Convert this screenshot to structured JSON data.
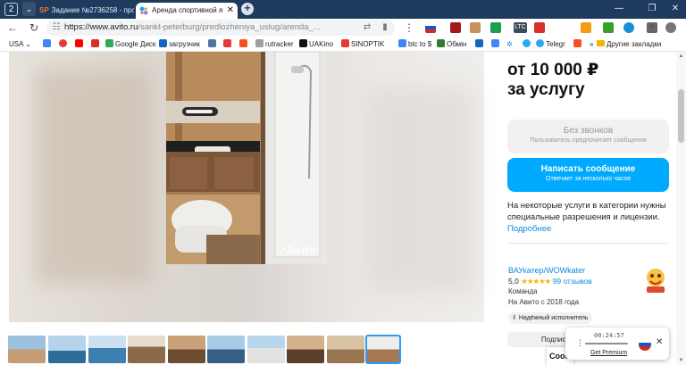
{
  "browser": {
    "tab_counter": "2",
    "tabs": [
      {
        "label": "Задание №2736258 - про",
        "active": false,
        "favicon_text": "SP"
      },
      {
        "label": "Аренда спортивной я",
        "active": true
      }
    ],
    "url_host": "https://www.avito.ru",
    "url_path": "/sankt-peterburg/predlozheniya_uslug/arenda_...",
    "extensions": [
      {
        "name": "flag-ru-icon",
        "color": "#d52b1e",
        "text": ""
      },
      {
        "name": "shield-ext-icon",
        "color": "#a11a1a",
        "text": ""
      },
      {
        "name": "face-ext-icon",
        "color": "#c9905a",
        "text": ""
      },
      {
        "name": "ext-green-icon",
        "color": "#1a9e52",
        "text": ""
      },
      {
        "name": "ltc-ext-icon",
        "color": "#3b4a5e",
        "text": "LTC"
      },
      {
        "name": "ext-red-icon",
        "color": "#d9302b",
        "text": ""
      },
      {
        "name": "download-ext-icon",
        "color": "#37a12b",
        "text": ""
      },
      {
        "name": "skype-ext-icon",
        "color": "#1b8fd6",
        "text": ""
      },
      {
        "name": "extensions-icon",
        "color": "#666666",
        "text": ""
      },
      {
        "name": "profile-icon",
        "color": "#777777",
        "text": ""
      }
    ],
    "bookmarks": [
      {
        "label": "USA",
        "color": "#ffffff"
      },
      {
        "label": "",
        "color": "#4285f4"
      },
      {
        "label": "",
        "color": "#e53935"
      },
      {
        "label": "",
        "color": "#ff0000"
      },
      {
        "label": "",
        "color": "#d93025"
      },
      {
        "label": "Google Диск",
        "color": "#34a853"
      },
      {
        "label": "загрузчик",
        "color": "#1565c0"
      },
      {
        "label": "",
        "color": "#4a76a8"
      },
      {
        "label": "",
        "color": "#e53935"
      },
      {
        "label": "",
        "color": "#f4511e"
      },
      {
        "label": "rutracker",
        "color": "#9e9e9e"
      },
      {
        "label": "UAKino",
        "color": "#111111"
      },
      {
        "label": "SINOPTIK",
        "color": "#e53935"
      },
      {
        "label": "btc to $",
        "color": "#4285f4"
      },
      {
        "label": "Обмін",
        "color": "#2e7d32"
      },
      {
        "label": "",
        "color": "#1565c0"
      },
      {
        "label": "",
        "color": "#4285f4"
      },
      {
        "label": "",
        "color": "#2aabee"
      },
      {
        "label": "Telegr",
        "color": "#2aabee"
      },
      {
        "label": "",
        "color": "#f4511e"
      },
      {
        "label": "",
        "color": "#1e88e5"
      }
    ],
    "other_bookmarks": "Другие закладки"
  },
  "listing": {
    "watermark": "Avito",
    "price": "от 10 000 ₽",
    "price_unit": "за услугу",
    "no_calls_title": "Без звонков",
    "no_calls_sub": "Пользователь предпочитает сообщения",
    "write_title": "Написать сообщение",
    "write_sub": "Отвечает за несколько часов",
    "note": "На некоторые услуги в категории нужны специальные разрешения и лицензии.",
    "more_link": "Подробнее",
    "seller_name": "ВАУкатер/WOWkater",
    "rating_value": "5,0",
    "stars": "★★★★★",
    "reviews": "99 отзывов",
    "seller_type": "Команда",
    "since": "На Авито с 2018 года",
    "badge": "Надёжный исполнитель",
    "subscribe": "Подписаться",
    "bottom_heading": "Сообщ"
  },
  "recorder": {
    "time": "00:24:57",
    "premium": "Get Premium"
  },
  "colors": {
    "accent": "#00aaff",
    "link": "#0a8ae0",
    "tabbar": "#1e3a5f"
  }
}
